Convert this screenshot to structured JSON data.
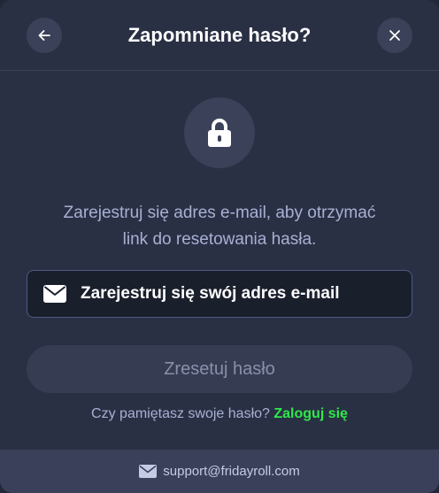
{
  "header": {
    "title": "Zapomniane hasło?",
    "back_icon": "arrow-left-icon",
    "close_icon": "close-icon"
  },
  "lock_icon": "lock-icon",
  "description": {
    "line1": "Zarejestruj się adres e-mail, aby otrzymać",
    "line2": "link do resetowania hasła."
  },
  "email_field": {
    "icon": "envelope-icon",
    "value": "",
    "placeholder": "Zarejestruj się swój adres e-mail"
  },
  "reset_button": {
    "label": "Zresetuj hasło"
  },
  "remember": {
    "question": "Czy pamiętasz swoje hasło?",
    "login_link": "Zaloguj się"
  },
  "footer": {
    "icon": "envelope-icon",
    "support_email": "support@fridayroll.com"
  },
  "colors": {
    "modal_bg": "#2a3044",
    "accent_green": "#2fe84a",
    "muted_text": "#a8b0d3",
    "field_border": "#4c5a86"
  }
}
